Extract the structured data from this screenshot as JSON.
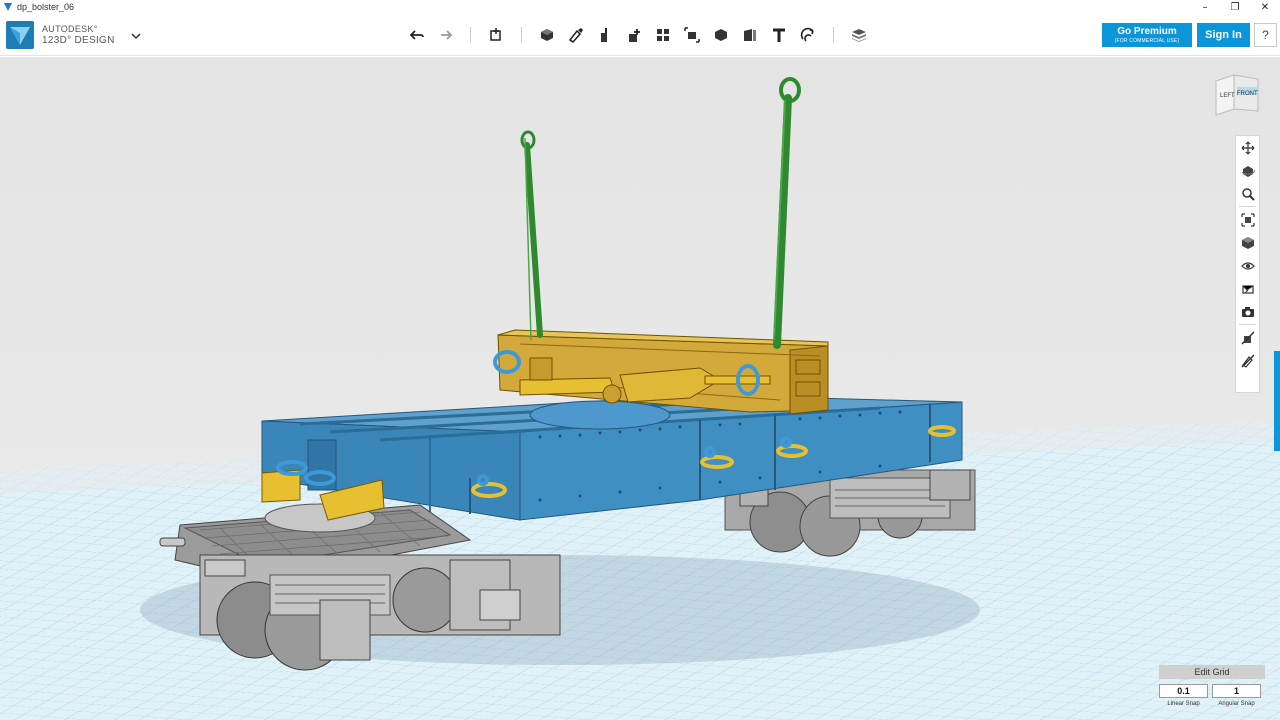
{
  "window": {
    "title": "dp_bolster_06",
    "controls": {
      "minimize": "–",
      "maximize": "❐",
      "close": "✕"
    }
  },
  "brand": {
    "line1": "AUTODESK°",
    "line2": "123D° DESIGN"
  },
  "toolbar": {
    "tools": [
      "undo-icon",
      "redo-icon",
      "transform-icon",
      "primitives-icon",
      "sketch-icon",
      "construct-icon",
      "modify-icon",
      "pattern-icon",
      "grouping-icon",
      "combine-icon",
      "measure-icon",
      "text-icon",
      "snap-icon",
      "material-icon"
    ]
  },
  "account": {
    "premium_title": "Go Premium",
    "premium_sub": "(FOR COMMERCIAL USE)",
    "sign_in": "Sign In",
    "help": "?"
  },
  "viewcube": {
    "left": "LEFT",
    "front": "FRONT"
  },
  "navbar": {
    "items": [
      "pan-icon",
      "orbit-icon",
      "zoom-icon",
      "fit-icon",
      "home-view-icon",
      "visibility-icon",
      "material-view-icon",
      "camera-icon",
      "hide-sketch-icon",
      "hide-objects-icon"
    ]
  },
  "grid": {
    "title": "Edit Grid",
    "linear_snap_value": "0.1",
    "angular_snap_value": "1",
    "linear_snap_label": "Linear Snap",
    "angular_snap_label": "Angular Snap"
  },
  "colors": {
    "accent": "#0a96d9",
    "grid": "#9fd3ec",
    "body": "#3a86b8",
    "bolster": "#c8a032",
    "rods": "#2f8a2f",
    "bogie": "#a9a9a9"
  }
}
